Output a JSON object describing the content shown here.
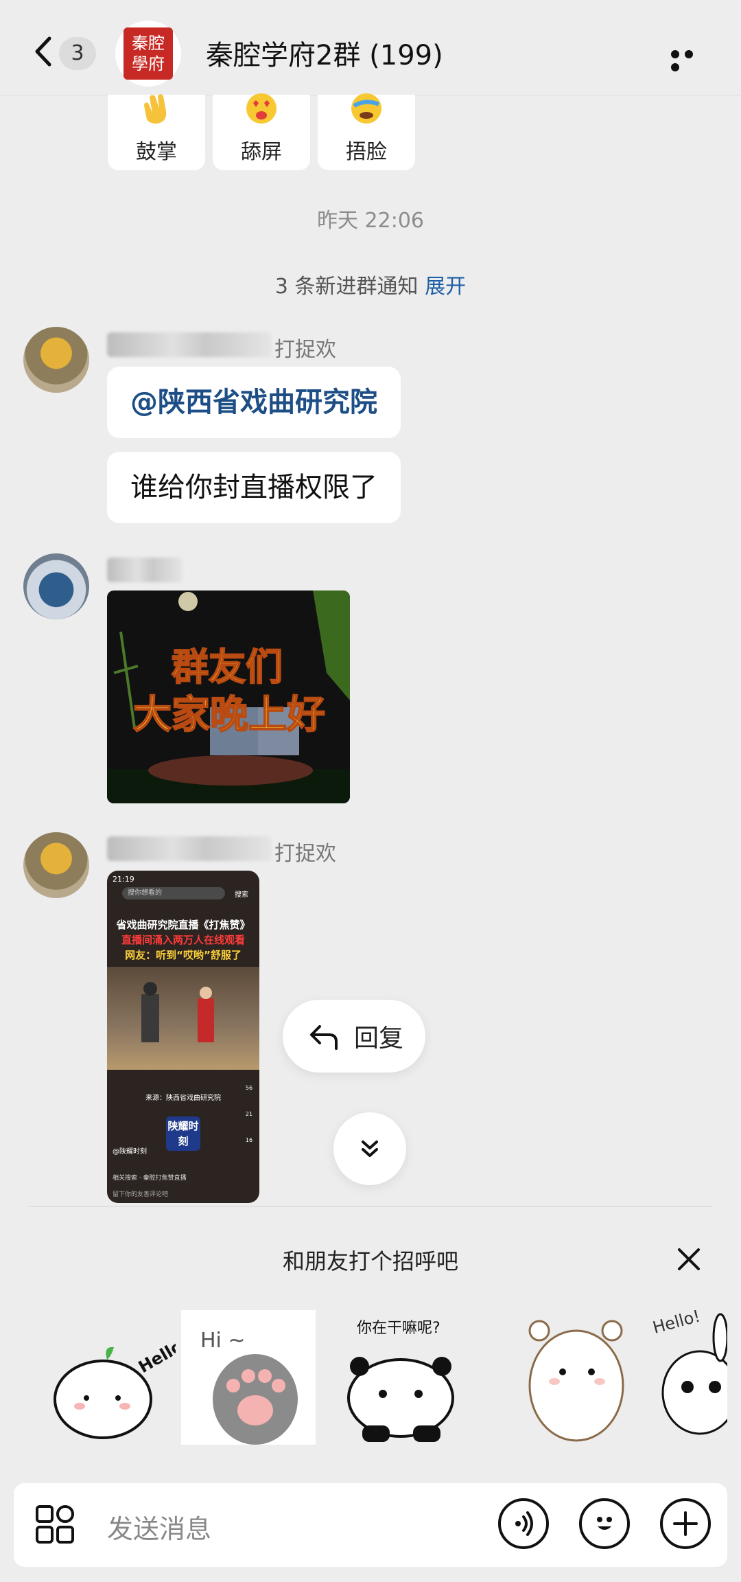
{
  "header": {
    "back_label": "",
    "unread_count": "3",
    "group_avatar_text": "秦腔學府",
    "title": "秦腔学府2群 (199)"
  },
  "reactions": [
    {
      "label": "鼓掌"
    },
    {
      "label": "舔屏"
    },
    {
      "label": "捂脸"
    }
  ],
  "chat": {
    "timestamp": "昨天 22:06",
    "notice_text": "3 条新进群通知 ",
    "notice_expand": "展开",
    "messages": [
      {
        "sender_tail": "打捉欢",
        "bubbles": [
          "@陕西省戏曲研究院",
          "谁给你封直播权限了"
        ]
      },
      {
        "sender_tail": "",
        "image_text": [
          "群友们",
          "大家晚上好"
        ]
      },
      {
        "sender_tail": "打捉欢",
        "screenshot": {
          "status_time": "21:19",
          "search_placeholder": "搜你想看的",
          "search_button": "搜索",
          "headline_1": "省戏曲研究院直播《打焦赞》",
          "headline_2": "直播间涌入两万人在线观看",
          "headline_3": "网友：听到“哎哟”舒服了",
          "source": "来源：陕西省戏曲研究院",
          "logo_text": "陕耀时刻",
          "account": "@陕耀时刻",
          "related": "相关搜索 · 秦腔打焦赞直播",
          "comment_placeholder": "留下你的友善评论吧",
          "counts": [
            "56",
            "21",
            "16"
          ]
        }
      }
    ]
  },
  "reply_label": "回复",
  "greeting": {
    "title": "和朋友打个招呼吧",
    "stickers": [
      {
        "caption": "Hello"
      },
      {
        "caption": "Hi ~"
      },
      {
        "caption": "你在干嘛呢?"
      },
      {
        "caption": ""
      },
      {
        "caption": "Hello!"
      }
    ]
  },
  "input": {
    "placeholder": "发送消息"
  }
}
